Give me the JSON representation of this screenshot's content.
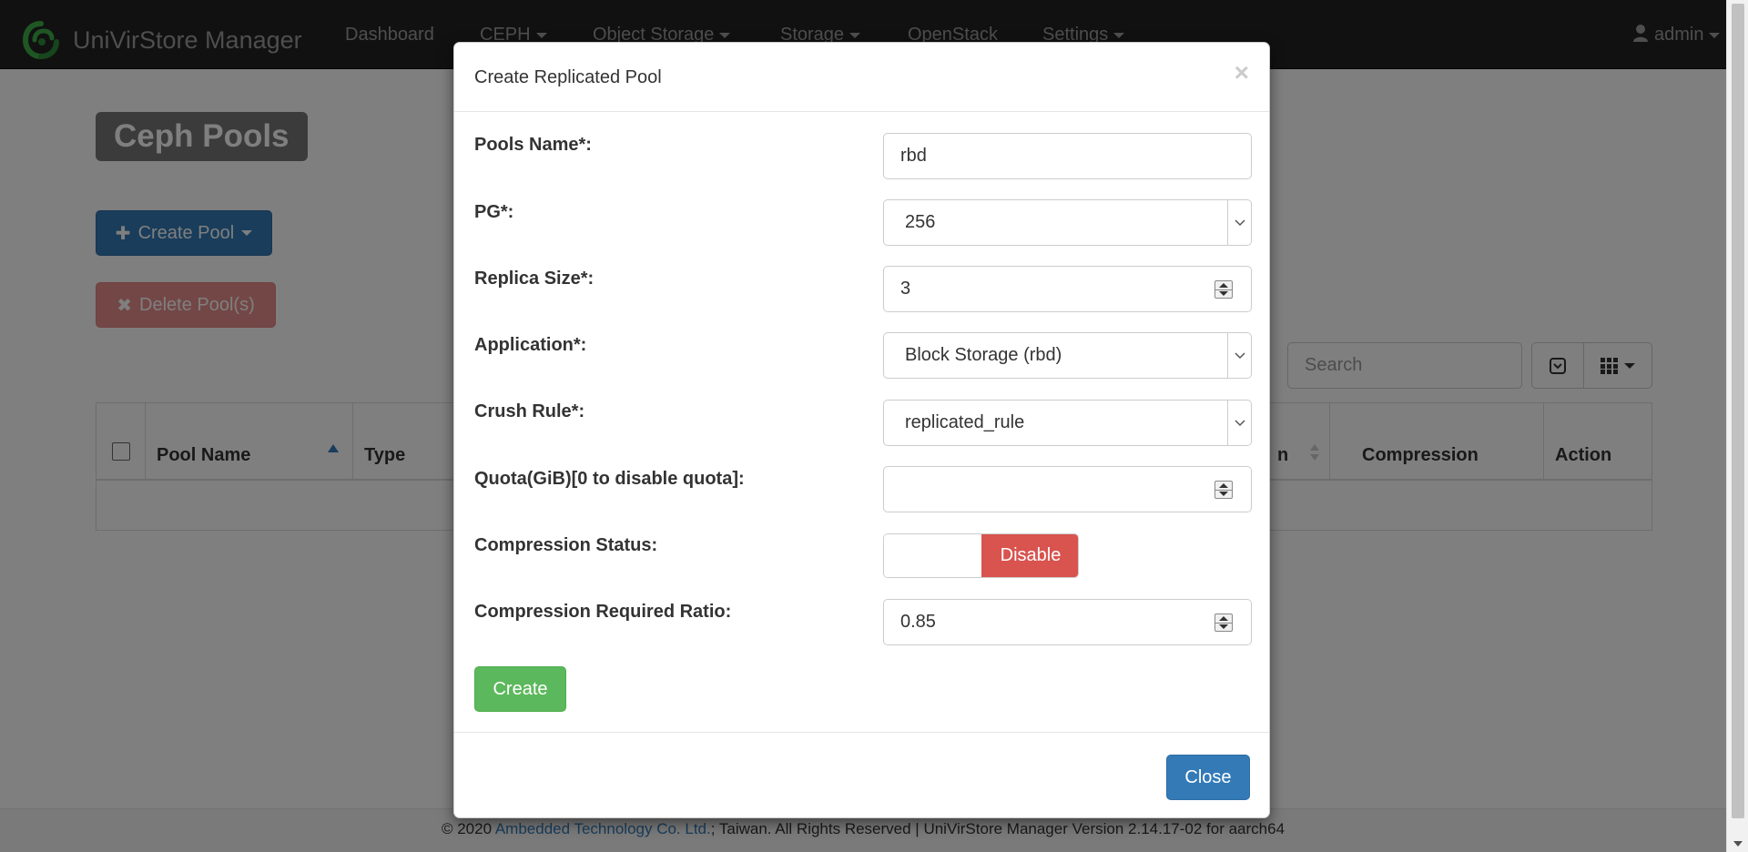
{
  "navbar": {
    "brand": "UniVirStore Manager",
    "logo_icon": "univirstore-logo-icon",
    "items": [
      {
        "label": "Dashboard"
      },
      {
        "label": "CEPH"
      },
      {
        "label": "Object Storage"
      },
      {
        "label": "Storage"
      },
      {
        "label": "OpenStack"
      },
      {
        "label": "Settings"
      }
    ],
    "user": "admin"
  },
  "page": {
    "title": "Ceph Pools",
    "create_pool_label": "Create Pool",
    "delete_pools_label": "Delete Pool(s)",
    "search_placeholder": "Search"
  },
  "table": {
    "columns": [
      "Pool Name",
      "Type",
      "Compression",
      "Action"
    ],
    "partial_column_suffix": "n"
  },
  "modal": {
    "title": "Create Replicated Pool",
    "close_x": "×",
    "fields": {
      "pool_name": {
        "label": "Pools Name*:",
        "value": "rbd"
      },
      "pg": {
        "label": "PG*:",
        "value": "256"
      },
      "replica_size": {
        "label": "Replica Size*:",
        "value": "3"
      },
      "application": {
        "label": "Application*:",
        "value": "Block Storage (rbd)"
      },
      "crush_rule": {
        "label": "Crush Rule*:",
        "value": "replicated_rule"
      },
      "quota": {
        "label": "Quota(GiB)[0 to disable quota]:",
        "value": ""
      },
      "compression_status": {
        "label": "Compression Status:",
        "value": "Disable"
      },
      "compression_ratio": {
        "label": "Compression Required Ratio:",
        "value": "0.85"
      }
    },
    "create_label": "Create",
    "close_label": "Close"
  },
  "footer": {
    "prefix": "© 2020 ",
    "company": "Ambedded Technology Co. Ltd.",
    "suffix": "; Taiwan. All Rights Reserved | UniVirStore Manager Version 2.14.17-02 for aarch64"
  },
  "colors": {
    "primary": "#337ab7",
    "danger": "#d9534f",
    "success": "#5cb85c",
    "navbar": "#222222",
    "logo": "#3fae49"
  }
}
